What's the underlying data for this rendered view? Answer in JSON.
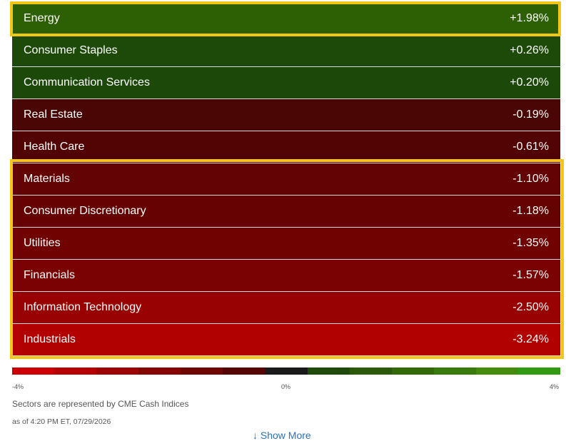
{
  "sectors": [
    {
      "name": "Energy",
      "change": "+1.98%",
      "color": "#2d5f05"
    },
    {
      "name": "Consumer Staples",
      "change": "+0.26%",
      "color": "#1d4a09"
    },
    {
      "name": "Communication Services",
      "change": "+0.20%",
      "color": "#1c4909"
    },
    {
      "name": "Real Estate",
      "change": "-0.19%",
      "color": "#4a0505"
    },
    {
      "name": "Health Care",
      "change": "-0.61%",
      "color": "#520404"
    },
    {
      "name": "Materials",
      "change": "-1.10%",
      "color": "#630303"
    },
    {
      "name": "Consumer Discretionary",
      "change": "-1.18%",
      "color": "#650303"
    },
    {
      "name": "Utilities",
      "change": "-1.35%",
      "color": "#700202"
    },
    {
      "name": "Financials",
      "change": "-1.57%",
      "color": "#7a0202"
    },
    {
      "name": "Information Technology",
      "change": "-2.50%",
      "color": "#990202"
    },
    {
      "name": "Industrials",
      "change": "-3.24%",
      "color": "#b20101"
    }
  ],
  "highlight_color": "#f3c613",
  "scale": {
    "colors": [
      "#cc0000",
      "#b50404",
      "#9e0606",
      "#860606",
      "#700505",
      "#560404",
      "#1a1a1a",
      "#1f4a0a",
      "#2a5a0a",
      "#326a0a",
      "#3a7a0a",
      "#468c0c",
      "#2f9a12"
    ],
    "min_label": "-4%",
    "mid_label": "0%",
    "max_label": "4%"
  },
  "source_note": "Sectors are represented by CME Cash Indices",
  "timestamp": "as of 4:20 PM ET, 07/29/2026",
  "show_more": "↓ Show More"
}
